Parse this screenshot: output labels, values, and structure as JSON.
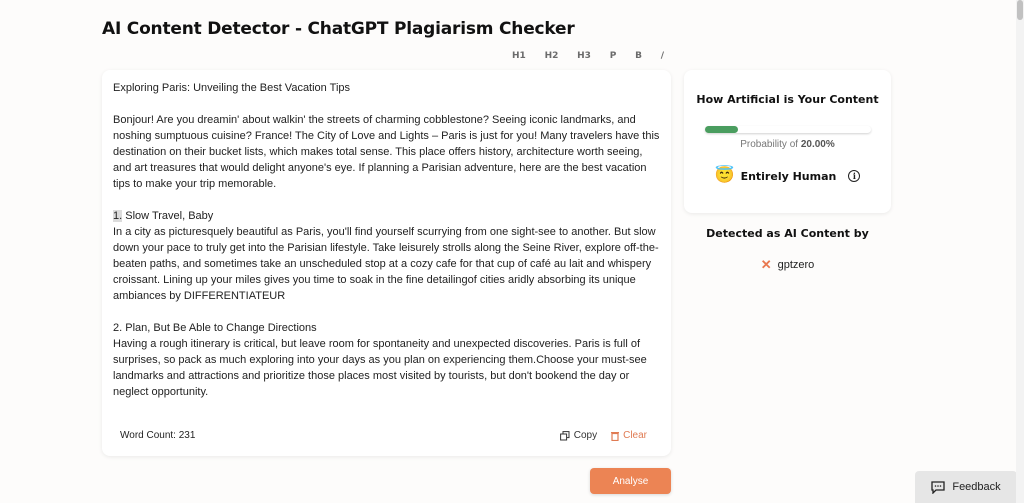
{
  "header": {
    "title": "AI Content Detector - ChatGPT Plagiarism Checker"
  },
  "format_toolbar": {
    "items": [
      "H1",
      "H2",
      "H3",
      "P",
      "B",
      "/"
    ]
  },
  "editor": {
    "title_line": "Exploring Paris: Unveiling the Best Vacation Tips",
    "intro": "Bonjour! Are you dreamin' about walkin' the streets of charming cobblestone? Seeing iconic landmarks, and noshing sumptuous cuisine? France! The City of Love and Lights – Paris is just for you! Many travelers have this destination on their bucket lists, which makes total sense. This place offers history, architecture worth seeing, and art treasures that would delight anyone's eye. If planning a Parisian adventure, here are the best vacation tips to make your trip memorable.",
    "section1_number": "1.",
    "section1_heading": " Slow Travel, Baby",
    "section1_body": "In a city as picturesquely beautiful as Paris, you'll find yourself scurrying from one sight-see to another. But slow down your pace to truly get into the Parisian lifestyle. Take leisurely strolls along the Seine River, explore off-the-beaten paths, and sometimes take an unscheduled stop at a cozy cafe for that cup of café au lait and whispery croissant. Lining up your miles gives you time to soak in the fine detailingof cities aridly absorbing its unique ambiances by DIFFERENTIATEUR",
    "section2_heading": "2. Plan, But Be Able to Change Directions",
    "section2_body": "Having a rough itinerary is critical, but leave room for spontaneity and unexpected discoveries. Paris is full of surprises, so pack as much exploring into your days as you plan on experiencing them.Choose your must-see landmarks and attractions and prioritize those places most visited by tourists, but don't bookend the day or neglect opportunity.",
    "word_count_label": "Word Count: 231",
    "copy_label": "Copy",
    "clear_label": "Clear"
  },
  "analyse_label": "Analyse",
  "result": {
    "title": "How Artificial is Your Content",
    "probability_prefix": "Probability of ",
    "probability_value": "20.00%",
    "probability_fraction": 0.2,
    "verdict_emoji": "😇",
    "verdict": "Entirely Human",
    "info_icon": "i"
  },
  "detected": {
    "title": "Detected as AI Content by",
    "detectors": [
      {
        "status_icon": "✕",
        "name": "gptzero"
      }
    ]
  },
  "feedback_label": "Feedback",
  "colors": {
    "accent": "#ec8454",
    "progress": "#4a9d5f",
    "clear": "#e07b53"
  }
}
